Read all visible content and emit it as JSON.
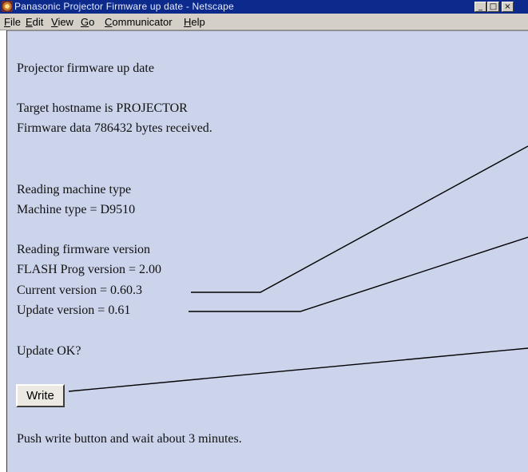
{
  "window": {
    "title": "Panasonic Projector Firmware up date - Netscape",
    "controls": {
      "minimize": "_",
      "maximize": "□",
      "close": "×"
    }
  },
  "menu": {
    "items": [
      {
        "pre": "",
        "key": "F",
        "post": "ile"
      },
      {
        "pre": "",
        "key": "E",
        "post": "dit"
      },
      {
        "pre": "",
        "key": "V",
        "post": "iew"
      },
      {
        "pre": "",
        "key": "G",
        "post": "o"
      },
      {
        "pre": "",
        "key": "C",
        "post": "ommunicator"
      },
      {
        "pre": "",
        "key": "H",
        "post": "elp"
      }
    ]
  },
  "content": {
    "heading": "Projector firmware up date",
    "target_host": "Target hostname is PROJECTOR",
    "data_received": "Firmware data 786432 bytes received.",
    "reading_machine": "Reading machine type",
    "machine_type": "Machine type = D9510",
    "reading_version": "Reading firmware version",
    "flash_prog": "FLASH Prog version = 2.00",
    "current_version": "Current version = 0.60.3",
    "update_version": "Update version = 0.61",
    "update_ok": "Update OK?",
    "write_label": "Write",
    "instruction": "Push write button and wait about 3 minutes."
  }
}
